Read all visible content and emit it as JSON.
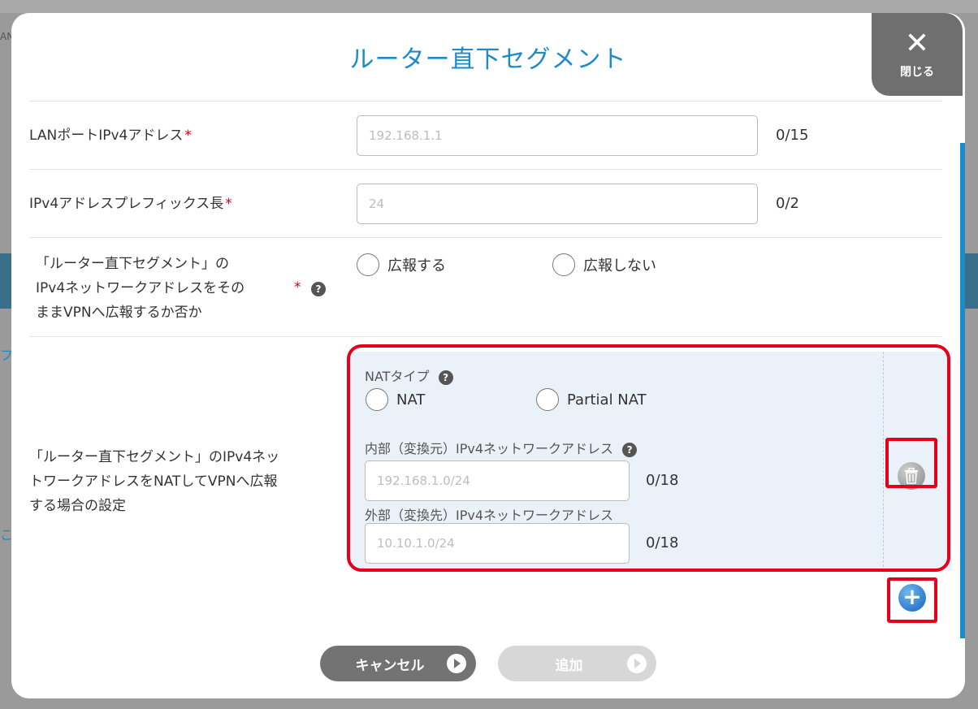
{
  "background": {
    "fragments": [
      "AN",
      "フ",
      "こ"
    ]
  },
  "modal": {
    "title": "ルーター直下セグメント",
    "close_label": "閉じる"
  },
  "form": {
    "lan_ip": {
      "label": "LANポートIPv4アドレス",
      "placeholder": "192.168.1.1",
      "counter": "0/15"
    },
    "prefix": {
      "label": "IPv4アドレスプレフィックス長",
      "placeholder": "24",
      "counter": "0/2"
    },
    "advertise": {
      "label_lines": [
        "「ルーター直下セグメント」の",
        "IPv4ネットワークアドレスをその",
        "ままVPNへ広報するか否か"
      ],
      "options": [
        "広報する",
        "広報しない"
      ]
    },
    "nat": {
      "label_lines": [
        "「ルーター直下セグメント」のIPv4ネッ",
        "トワークアドレスをNATしてVPNへ広報",
        "する場合の設定"
      ],
      "type_label": "NATタイプ",
      "type_options": [
        "NAT",
        "Partial NAT"
      ],
      "internal_label": "内部（変換元）IPv4ネットワークアドレス",
      "internal_placeholder": "192.168.1.0/24",
      "internal_counter": "0/18",
      "external_label": "外部（変換先）IPv4ネットワークアドレス",
      "external_placeholder": "10.10.1.0/24",
      "external_counter": "0/18"
    }
  },
  "footer": {
    "cancel_label": "キャンセル",
    "add_label": "追加"
  },
  "colors": {
    "accent": "#1d8bc9",
    "required": "#d0021b",
    "highlight": "#e5001c"
  }
}
